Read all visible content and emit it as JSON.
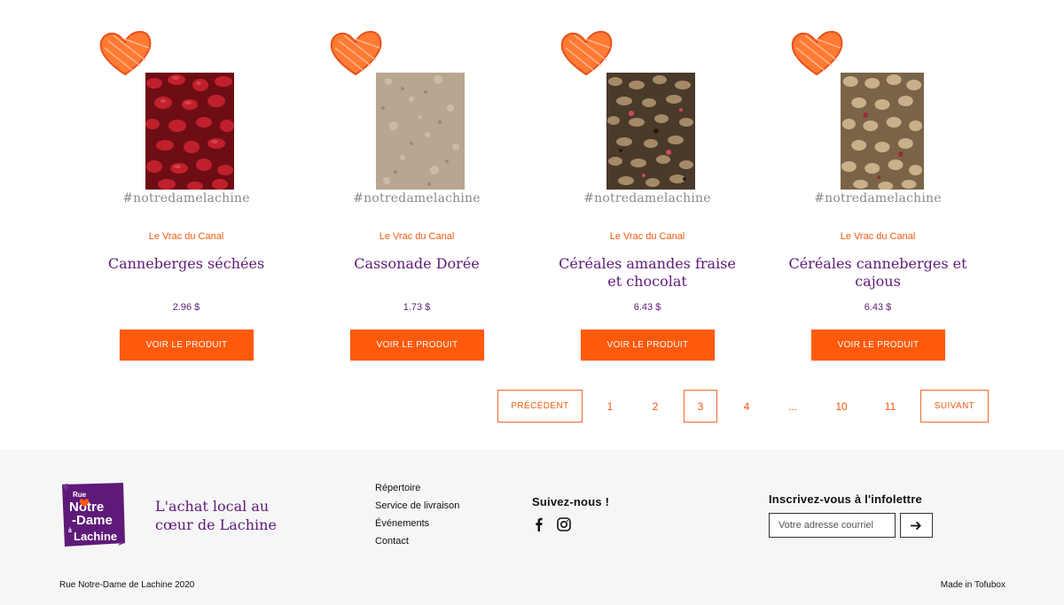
{
  "products": [
    {
      "hashtag": "#notredamelachine",
      "vendor": "Le Vrac du Canal",
      "name": "Canneberges séchées",
      "price": "2.96 $",
      "button": "VOIR LE PRODUIT",
      "image": "dried-cranberries"
    },
    {
      "hashtag": "#notredamelachine",
      "vendor": "Le Vrac du Canal",
      "name": "Cassonade Dorée",
      "price": "1.73 $",
      "button": "VOIR LE PRODUIT",
      "image": "brown-sugar"
    },
    {
      "hashtag": "#notredamelachine",
      "vendor": "Le Vrac du Canal",
      "name": "Céréales amandes fraise et chocolat",
      "price": "6.43 $",
      "button": "VOIR LE PRODUIT",
      "image": "granola-strawberry-chocolate"
    },
    {
      "hashtag": "#notredamelachine",
      "vendor": "Le Vrac du Canal",
      "name": "Céréales canneberges et cajous",
      "price": "6.43 $",
      "button": "VOIR LE PRODUIT",
      "image": "granola-cranberry-cashew"
    }
  ],
  "pagination": {
    "previous": "PRÉCÉDENT",
    "next": "SUIVANT",
    "pages": [
      "1",
      "2",
      "3",
      "4",
      "...",
      "10",
      "11"
    ],
    "current": "3"
  },
  "footer": {
    "logo_text": "Rue Notre-Dame à Lachine",
    "tagline": "L'achat local au cœur de Lachine",
    "nav": [
      "Répertoire",
      "Service de livraison",
      "Événements",
      "Contact"
    ],
    "social_title": "Suivez-nous !",
    "social_icons": [
      "facebook-icon",
      "instagram-icon"
    ],
    "newsletter_title": "Inscrivez-vous à l'infolettre",
    "newsletter_placeholder": "Votre adresse courriel",
    "copyright": "Rue Notre-Dame de Lachine 2020",
    "made_in": "Made in Tofubox"
  },
  "colors": {
    "accent": "#ff5a0c",
    "brand_purple": "#5e1a78",
    "footer_bg": "#f6f6f6"
  }
}
